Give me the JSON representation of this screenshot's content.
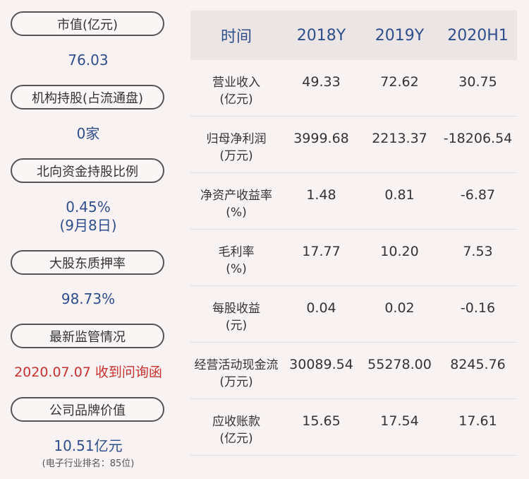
{
  "left": {
    "items": [
      {
        "label": "市值(亿元)",
        "value": "76.03"
      },
      {
        "label": "机构持股(占流通盘)",
        "value": "0家"
      },
      {
        "label": "北向资金持股比例",
        "value": "0.45%",
        "value2": "(9月8日)"
      },
      {
        "label": "大股东质押率",
        "value": "98.73%"
      },
      {
        "label": "最新监管情况",
        "value": "2020.07.07 收到问询函"
      },
      {
        "label": "公司品牌价值",
        "value": "10.51亿元",
        "note": "(电子行业排名：85位)"
      }
    ]
  },
  "table": {
    "headers": [
      "时间",
      "2018Y",
      "2019Y",
      "2020H1"
    ],
    "rows": [
      {
        "name": "营业收入",
        "unit": "(亿元)",
        "values": [
          "49.33",
          "72.62",
          "30.75"
        ]
      },
      {
        "name": "归母净利润",
        "unit": "(万元)",
        "values": [
          "3999.68",
          "2213.37",
          "-18206.54"
        ]
      },
      {
        "name": "净资产收益率",
        "unit": "(%)",
        "values": [
          "1.48",
          "0.81",
          "-6.87"
        ]
      },
      {
        "name": "毛利率",
        "unit": "(%)",
        "values": [
          "17.77",
          "10.20",
          "7.53"
        ]
      },
      {
        "name": "每股收益",
        "unit": "(元)",
        "values": [
          "0.04",
          "0.02",
          "-0.16"
        ]
      },
      {
        "name": "经营活动现金流",
        "unit": "(万元)",
        "values": [
          "30089.54",
          "55278.00",
          "8245.76"
        ]
      },
      {
        "name": "应收账款",
        "unit": "(亿元)",
        "values": [
          "15.65",
          "17.54",
          "17.61"
        ]
      }
    ]
  },
  "colors": {
    "accent": "#2f4e8c",
    "alert": "#c8312d",
    "background": "#f8f2f2"
  }
}
